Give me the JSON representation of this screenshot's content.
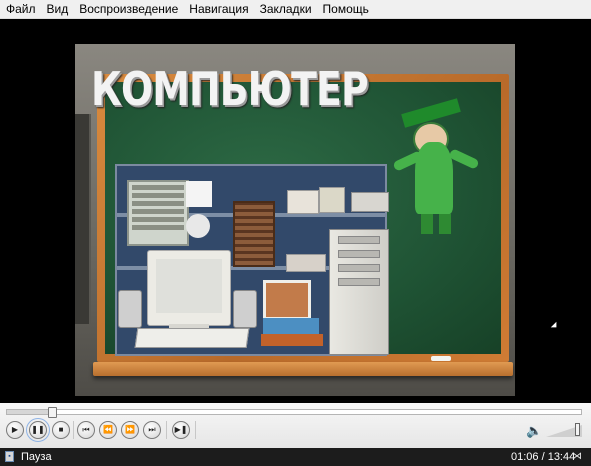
{
  "menu": {
    "items": [
      "Файл",
      "Вид",
      "Воспроизведение",
      "Навигация",
      "Закладки",
      "Помощь"
    ]
  },
  "video": {
    "board_title": "КОМПЬЮТЕР"
  },
  "controls": {
    "buttons": [
      {
        "name": "play",
        "icon": "play-icon",
        "glyph": "▶"
      },
      {
        "name": "pause",
        "icon": "pause-icon",
        "glyph": "❚❚"
      },
      {
        "name": "stop",
        "icon": "stop-icon",
        "glyph": "■"
      },
      {
        "name": "previous",
        "icon": "skip-previous-icon",
        "glyph": "⏮"
      },
      {
        "name": "rewind",
        "icon": "rewind-icon",
        "glyph": "⏪"
      },
      {
        "name": "fast-forward",
        "icon": "fast-forward-icon",
        "glyph": "⏩"
      },
      {
        "name": "next",
        "icon": "skip-next-icon",
        "glyph": "⏭"
      },
      {
        "name": "frame-step",
        "icon": "frame-step-icon",
        "glyph": "▶❚"
      }
    ],
    "volume_icon": "speaker-icon",
    "volume_glyph": "🔈",
    "volume_level": 0.9,
    "seek_progress_fraction": 0.08
  },
  "status": {
    "state": "Пауза",
    "time": "01:06 / 13:44",
    "speed_icon": "bowtie-speed-icon"
  },
  "colors": {
    "menu_bg": "#f0f0f0",
    "board_green": "#1f5334",
    "frame_orange": "#d88a3e",
    "status_bg": "#1c1c1c"
  }
}
